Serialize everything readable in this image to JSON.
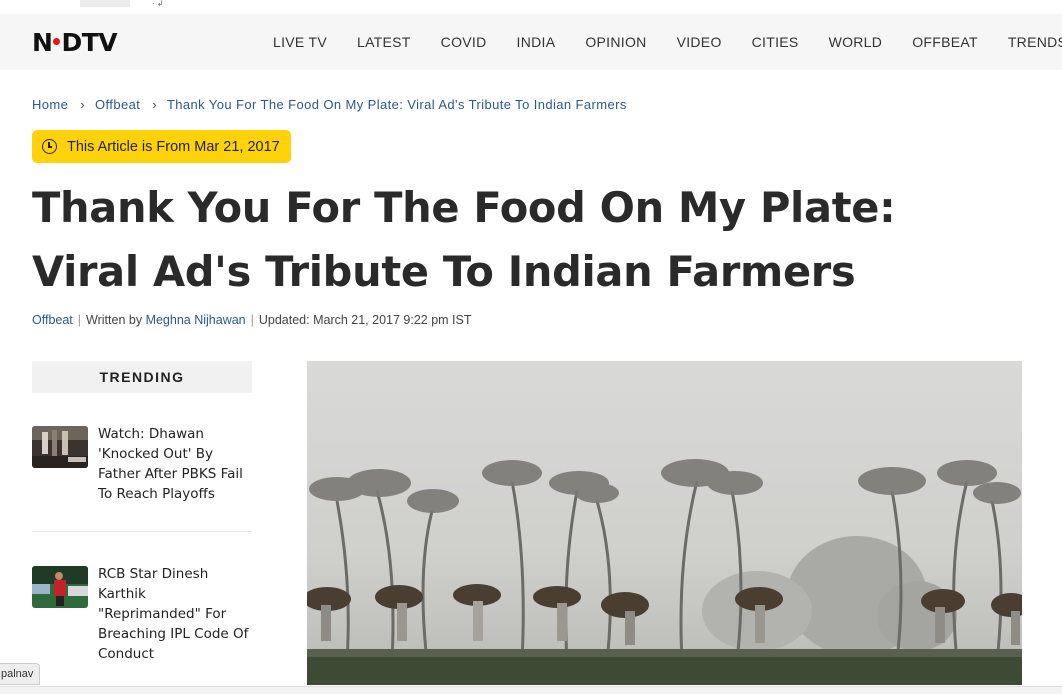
{
  "site": {
    "logo_text": "NDTV"
  },
  "nav": {
    "items": [
      "LIVE TV",
      "LATEST",
      "COVID",
      "INDIA",
      "OPINION",
      "VIDEO",
      "CITIES",
      "WORLD",
      "OFFBEAT",
      "TRENDS"
    ]
  },
  "breadcrumb": {
    "home": "Home",
    "section": "Offbeat",
    "current": "Thank You For The Food On My Plate: Viral Ad's Tribute To Indian Farmers"
  },
  "date_badge": {
    "text": "This Article is From Mar 21, 2017"
  },
  "article": {
    "title": "Thank You For The Food On My Plate: Viral Ad's Tribute To Indian Farmers",
    "category": "Offbeat",
    "written_by_prefix": "Written by",
    "author": "Meghna Nijhawan",
    "updated": "Updated: March 21, 2017 9:22 pm IST"
  },
  "trending": {
    "heading": "TRENDING",
    "items": [
      {
        "title": "Watch: Dhawan 'Knocked Out' By Father After PBKS Fail To Reach Playoffs"
      },
      {
        "title": "RCB Star Dinesh Karthik \"Reprimanded\" For Breaching IPL Code Of Conduct"
      }
    ]
  },
  "status": {
    "text": "palnav"
  },
  "colors": {
    "badge": "#ffd20a",
    "link": "#2a5a8a",
    "header_bg": "#f6f6f6",
    "logo_dot": "#ee1111"
  }
}
